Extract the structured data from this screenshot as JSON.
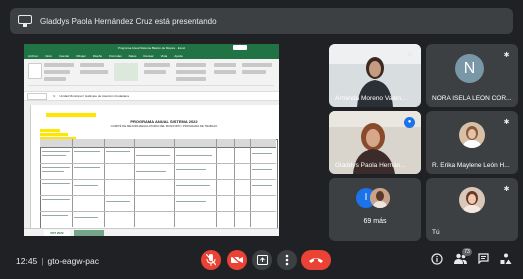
{
  "banner": {
    "text": "Gladdys Paola Hernández Cruz está presentando"
  },
  "presentation": {
    "window_title": "Programa Anual Sistema Básico de Mejora · Excel",
    "menu": [
      "Archivo",
      "Inicio",
      "Insertar",
      "Dibujar",
      "Diseño",
      "Fórmulas",
      "Datos",
      "Revisar",
      "Vista",
      "Ayuda"
    ],
    "formula_text": "Unidad Municipal / Gabinete de Atención Ciudadana",
    "sheet_title": "PROGRAMA ANUAL SISTEMA 2022",
    "sheet_subtitle": "COMITÉ DE MEJORA REGULATORIA DEL MUNICIPIO / PROGRAMA DE TRABAJO",
    "sheet_tab": "PAT 2022"
  },
  "participants": [
    {
      "name": "Arminda Moreno Valen...",
      "mic": "muted"
    },
    {
      "name": "NORA ISELA LEON COR...",
      "initial": "N",
      "mic": "muted"
    },
    {
      "name": "Gladdys Paola Hernán...",
      "mic": "speaking"
    },
    {
      "name": "R. Erika Maylene León H...",
      "mic": "muted"
    },
    {
      "more_initial": "I",
      "more_label": "69 más"
    },
    {
      "name": "Tú",
      "mic": "muted"
    }
  ],
  "meeting": {
    "time": "12:45",
    "separator": "|",
    "code": "gto-eagw-pac"
  },
  "people_count": "73",
  "colors": {
    "background": "#202124",
    "tile": "#3c4043",
    "red": "#ea4335",
    "active_outline": "#8ab4f8",
    "excel_green": "#217346"
  },
  "icons": {
    "mic_off": "mic-off-icon",
    "cam_off": "videocam-off-icon",
    "present": "present-to-all-icon",
    "more": "more-vert-icon",
    "hangup": "call-end-icon",
    "info": "info-icon",
    "people": "people-icon",
    "chat": "chat-icon",
    "activities": "activities-icon"
  }
}
